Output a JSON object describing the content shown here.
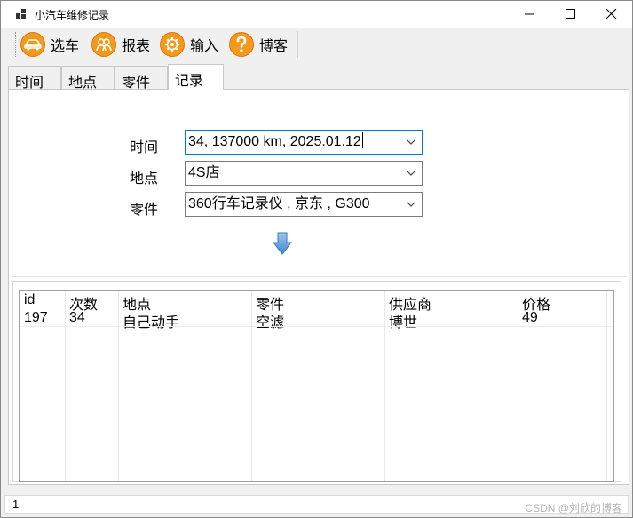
{
  "window": {
    "title": "小汽车维修记录"
  },
  "toolbar": {
    "items": [
      {
        "label": "选车",
        "icon": "car-icon"
      },
      {
        "label": "报表",
        "icon": "people-icon"
      },
      {
        "label": "输入",
        "icon": "gear-icon"
      },
      {
        "label": "博客",
        "icon": "help-icon"
      }
    ]
  },
  "tabs": [
    {
      "label": "时间",
      "active": false
    },
    {
      "label": "地点",
      "active": false
    },
    {
      "label": "零件",
      "active": false
    },
    {
      "label": "记录",
      "active": true
    }
  ],
  "form": {
    "time_label": "时间",
    "time_value": "34, 137000 km, 2025.01.12",
    "place_label": "地点",
    "place_value": "4S店",
    "part_label": "零件",
    "part_value": "360行车记录仪 , 京东 , G300"
  },
  "table": {
    "columns": [
      "id",
      "次数",
      "地点",
      "零件",
      "供应商",
      "价格"
    ],
    "rows": [
      [
        "197",
        "34",
        "自己动手",
        "空滤",
        "博世",
        "49"
      ]
    ]
  },
  "status": {
    "text": "1"
  },
  "watermark": "CSDN @刘欣的博客",
  "colors": {
    "accent": "#0078d7",
    "icon_orange": "#f39a1d",
    "arrow_blue": "#4a90d9"
  }
}
